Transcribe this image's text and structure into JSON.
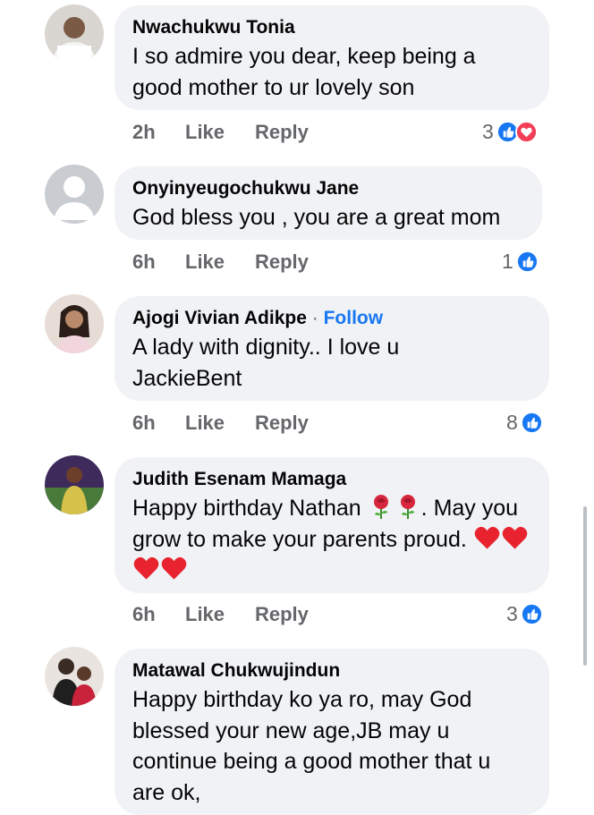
{
  "comments": [
    {
      "author": "Nwachukwu Tonia",
      "text": "I so admire you dear, keep being a good mother to ur lovely son",
      "time": "2h",
      "like_label": "Like",
      "reply_label": "Reply",
      "reaction_count": "3",
      "reactions": [
        "like-icon",
        "love-icon"
      ]
    },
    {
      "author": "Onyinyeugochukwu Jane",
      "text": "God bless you , you are a great mom",
      "time": "6h",
      "like_label": "Like",
      "reply_label": "Reply",
      "reaction_count": "1",
      "reactions": [
        "like-icon"
      ]
    },
    {
      "author": "Ajogi Vivian Adikpe",
      "separator": "·",
      "follow_label": "Follow",
      "text": "A lady with dignity.. I love u JackieBent",
      "time": "6h",
      "like_label": "Like",
      "reply_label": "Reply",
      "reaction_count": "8",
      "reactions": [
        "like-icon"
      ]
    },
    {
      "author": "Judith Esenam Mamaga",
      "text_part1": "Happy birthday Nathan",
      "text_part2": ". May you grow to make your parents proud.",
      "emojis_roses": [
        "rose-emoji",
        "rose-emoji"
      ],
      "emojis_hearts": [
        "heart-emoji",
        "heart-emoji",
        "heart-emoji",
        "heart-emoji"
      ],
      "time": "6h",
      "like_label": "Like",
      "reply_label": "Reply",
      "reaction_count": "3",
      "reactions": [
        "like-icon"
      ]
    },
    {
      "author": "Matawal Chukwujindun",
      "text": "Happy birthday ko ya ro, may God blessed your new age,JB may u continue being a good mother that u are ok,"
    }
  ],
  "colors": {
    "bubble": "#f0f2f5",
    "meta_text": "#65676b",
    "follow": "#1877f2",
    "like_blue": "#1877f2",
    "love_red": "#f33e58"
  }
}
